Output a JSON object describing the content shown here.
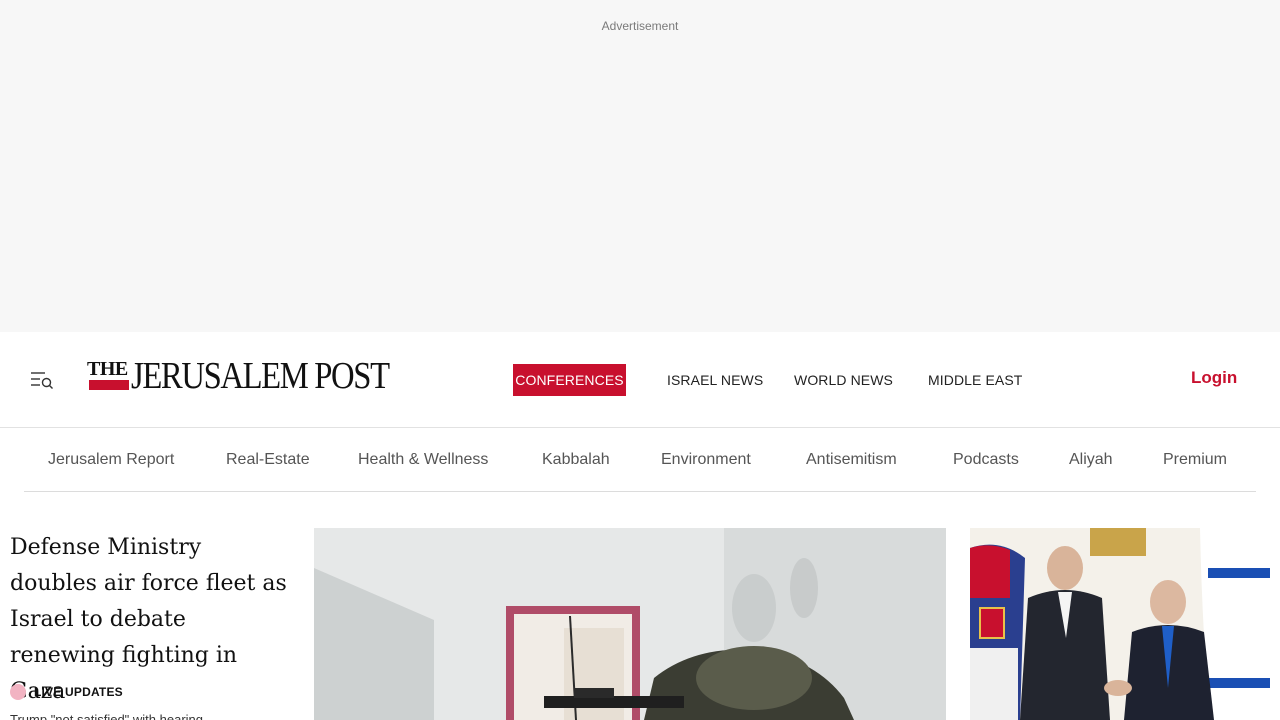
{
  "ad": {
    "label": "Advertisement"
  },
  "header": {
    "logo": {
      "the": "THE",
      "name": "JERUSALEM POST"
    },
    "nav": [
      "CONFERENCES",
      "ISRAEL NEWS",
      "WORLD NEWS",
      "MIDDLE EAST"
    ],
    "login": "Login",
    "colors": {
      "accent": "#c8102e"
    }
  },
  "subnav": [
    "Jerusalem Report",
    "Real-Estate",
    "Health & Wellness",
    "Kabbalah",
    "Environment",
    "Antisemitism",
    "Podcasts",
    "Aliyah",
    "Premium"
  ],
  "lead": {
    "title": "Defense Ministry doubles air force fleet as Israel to debate renewing fighting in Gaza",
    "live_label": "LIVE UPDATES",
    "subtitle": "Trump \"not satisfied\" with hearing"
  },
  "icons": {
    "menu": "menu-search-icon",
    "live": "live-dot-icon"
  }
}
